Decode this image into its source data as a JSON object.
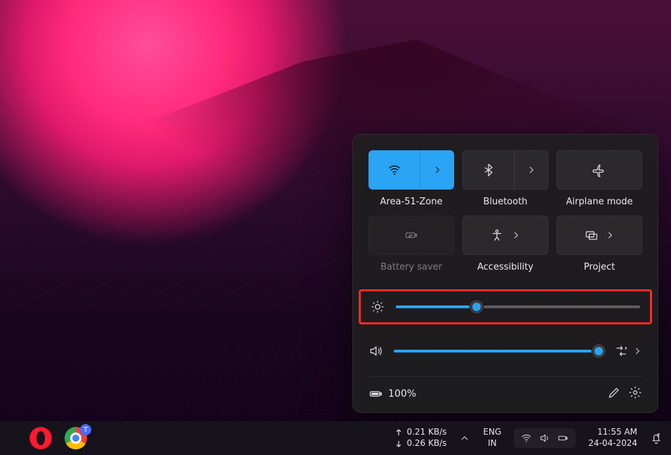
{
  "tiles": {
    "wifi": {
      "label": "Area-51-Zone"
    },
    "bluetooth": {
      "label": "Bluetooth"
    },
    "airplane": {
      "label": "Airplane mode"
    },
    "battery_saver": {
      "label": "Battery saver"
    },
    "accessibility": {
      "label": "Accessibility"
    },
    "project": {
      "label": "Project"
    }
  },
  "sliders": {
    "brightness_percent": 33,
    "volume_percent": 98
  },
  "footer": {
    "battery_percent_text": "100%"
  },
  "taskbar": {
    "chrome_badge": "T",
    "net_up": "0.21 KB/s",
    "net_down": "0.26 KB/s",
    "lang_line1": "ENG",
    "lang_line2": "IN",
    "time": "11:55 AM",
    "date": "24-04-2024"
  }
}
